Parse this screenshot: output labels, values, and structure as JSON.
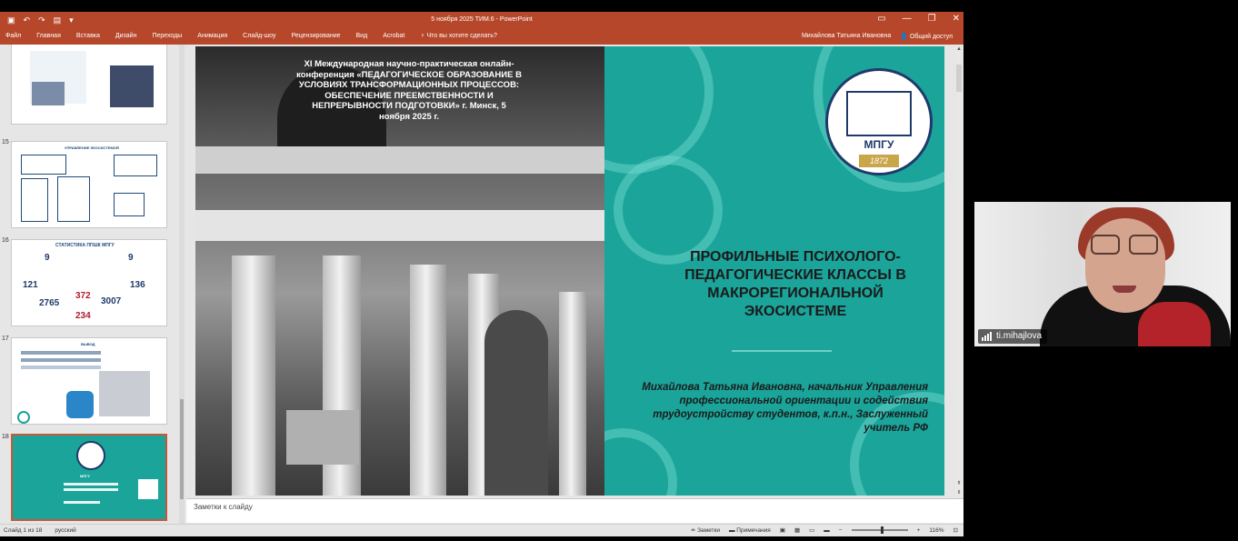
{
  "window": {
    "title": "5 ноября 2025 ТИМ.6 - PowerPoint",
    "user": "Михайлова Татьяна Ивановна",
    "share": "Общий доступ"
  },
  "ribbon": {
    "tabs": [
      "Файл",
      "Главная",
      "Вставка",
      "Дизайн",
      "Переходы",
      "Анимация",
      "Слайд-шоу",
      "Рецензирование",
      "Вид",
      "Acrobat"
    ],
    "search": "Что вы хотите сделать?"
  },
  "thumbnails": [
    {
      "number": "",
      "title": ""
    },
    {
      "number": "15",
      "title": "УПРАВЛЕНИЕ ЭКОСИСТЕМОЙ"
    },
    {
      "number": "16",
      "title": "СТАТИСТИКА ППШК МПГУ",
      "stats": [
        "121",
        "136",
        "2765",
        "372",
        "3007",
        "234",
        "9",
        "9"
      ]
    },
    {
      "number": "17",
      "title": "ВЫВОД"
    },
    {
      "number": "18",
      "title": "МПГУ",
      "selected": true
    }
  ],
  "slide": {
    "conference": "XI Международная научно-практическая онлайн-конференция «ПЕДАГОГИЧЕСКОЕ ОБРАЗОВАНИЕ В УСЛОВИЯХ ТРАНСФОРМАЦИОННЫХ ПРОЦЕССОВ: ОБЕСПЕЧЕНИЕ ПРЕЕМСТВЕННОСТИ И НЕПРЕРЫВНОСТИ ПОДГОТОВКИ» г. Минск, 5 ноября 2025 г.",
    "seal_word": "МПГУ",
    "seal_year": "1872",
    "title": "ПРОФИЛЬНЫЕ ПСИХОЛОГО-ПЕДАГОГИЧЕСКИЕ КЛАССЫ В МАКРОРЕГИОНАЛЬНОЙ ЭКОСИСТЕМЕ",
    "author": "Михайлова Татьяна Ивановна, начальник Управления профессиональной ориентации и содействия трудоустройству студентов, к.п.н., Заслуженный учитель РФ"
  },
  "notes_placeholder": "Заметки к слайду",
  "status": {
    "slide": "Слайд 1 из 18",
    "language": "русский",
    "notes": "Заметки",
    "comments": "Примечания",
    "zoom": "116%"
  },
  "webcam": {
    "name": "ti.mihajlova"
  },
  "colors": {
    "accent": "#b7472a",
    "teal": "#1aa49a",
    "navy": "#1f3a6a",
    "gold": "#c9a64a"
  }
}
